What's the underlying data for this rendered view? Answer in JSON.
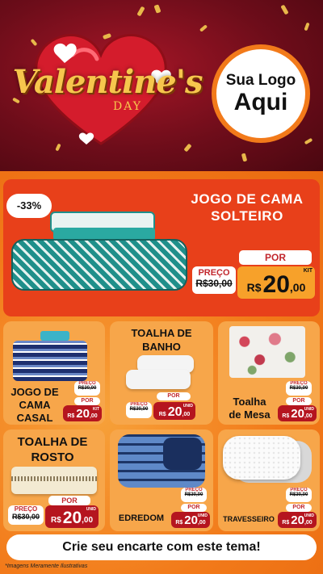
{
  "header": {
    "title": "Valentine's",
    "subtitle": "DAY",
    "logo_line1": "Sua Logo",
    "logo_line2": "Aqui"
  },
  "featured": {
    "discount": "-33%",
    "title_line1": "JOGO DE CAMA",
    "title_line2": "SOLTEIRO",
    "price_label": "PREÇO",
    "old_price": "R$30,00",
    "por_label": "POR",
    "currency": "R$",
    "price_int": "20",
    "price_cents": ",00",
    "unit": "KIT"
  },
  "products": [
    {
      "title_line1": "JOGO DE",
      "title_line2": "CAMA",
      "title_line3": "CASAL",
      "price_label": "PREÇO",
      "old_price": "R$30,00",
      "por_label": "POR",
      "currency": "R$",
      "price_int": "20",
      "price_cents": ",00",
      "unit": "KIT"
    },
    {
      "title_line1": "TOALHA DE",
      "title_line2": "BANHO",
      "price_label": "PREÇO",
      "old_price": "R$30,00",
      "por_label": "POR",
      "currency": "R$",
      "price_int": "20",
      "price_cents": ",00",
      "unit": "UNID"
    },
    {
      "title_line1": "Toalha",
      "title_line2": "de Mesa",
      "price_label": "PREÇO",
      "old_price": "R$30,00",
      "por_label": "POR",
      "currency": "R$",
      "price_int": "20",
      "price_cents": ",00",
      "unit": "UNID"
    },
    {
      "title_line1": "TOALHA DE",
      "title_line2": "ROSTO",
      "price_label": "PREÇO",
      "old_price": "R$30,00",
      "por_label": "POR",
      "currency": "R$",
      "price_int": "20",
      "price_cents": ",00",
      "unit": "UNID"
    },
    {
      "title_line1": "EDREDOM",
      "price_label": "PREÇO",
      "old_price": "R$30,00",
      "por_label": "POR",
      "currency": "R$",
      "price_int": "20",
      "price_cents": ",00",
      "unit": "UNID"
    },
    {
      "title_line1": "TRAVESSEIRO",
      "price_label": "PREÇO",
      "old_price": "R$30,00",
      "por_label": "POR",
      "currency": "R$",
      "price_int": "20",
      "price_cents": ",00",
      "unit": "UNID"
    }
  ],
  "footer": {
    "cta": "Crie seu encarte com este tema!",
    "disclaimer": "*Imagens Meramente Ilustrativas"
  },
  "colors": {
    "header_red": "#6e0d1a",
    "orange": "#f27a1a",
    "featured_red": "#e8401a",
    "price_red": "#b5151f",
    "gold": "#f6c64d"
  }
}
